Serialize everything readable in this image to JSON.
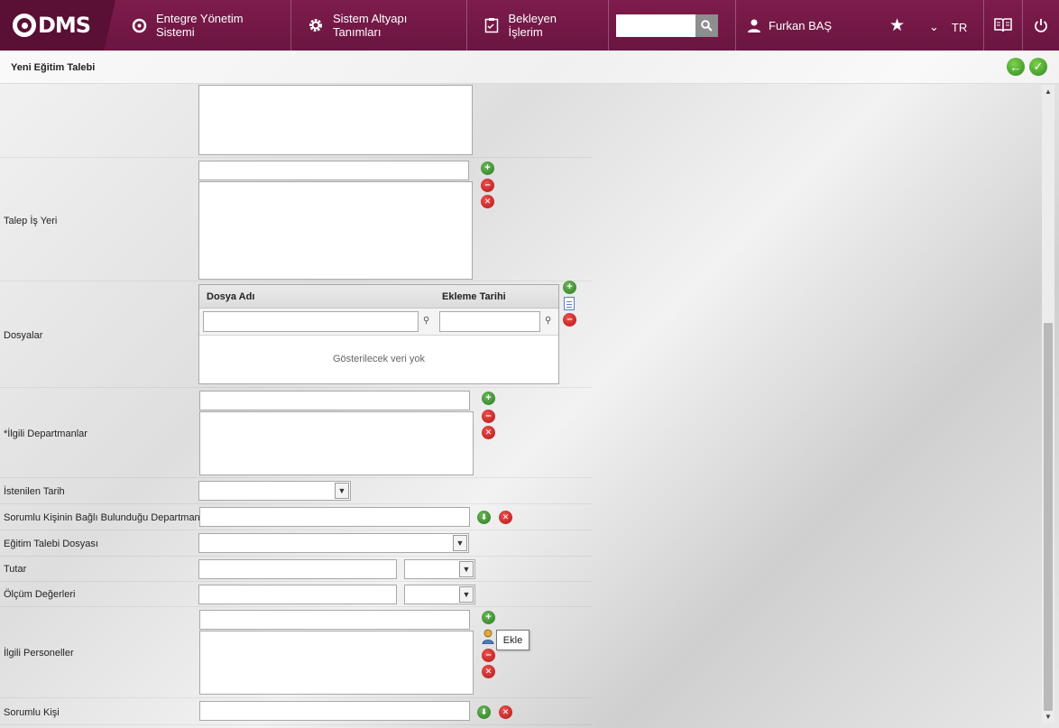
{
  "header": {
    "logo_text": "DMS",
    "nav": [
      {
        "label": "Entegre Yönetim Sistemi",
        "icon": "q-logo-icon"
      },
      {
        "label": "Sistem Altyapı Tanımları",
        "icon": "gear-icon"
      },
      {
        "label": "Bekleyen İşlerim",
        "icon": "clipboard-icon"
      }
    ],
    "search_placeholder": "",
    "user_name": "Furkan BAŞ",
    "language": "TR"
  },
  "page": {
    "title": "Yeni Eğitim Talebi"
  },
  "form": {
    "talep_is_yeri": {
      "label": "Talep İş Yeri"
    },
    "dosyalar": {
      "label": "Dosyalar",
      "columns": [
        "Dosya Adı",
        "Ekleme Tarihi"
      ],
      "empty_text": "Gösterilecek veri yok"
    },
    "ilgili_departmanlar": {
      "label": "*İlgili Departmanlar"
    },
    "istenilen_tarih": {
      "label": "İstenilen Tarih"
    },
    "sorumlu_departman": {
      "label": "Sorumlu Kişinin Bağlı Bulunduğu Departman"
    },
    "egitim_talebi_dosyasi": {
      "label": "Eğitim Talebi Dosyası"
    },
    "tutar": {
      "label": "Tutar"
    },
    "olcum_degerleri": {
      "label": "Ölçüm Değerleri"
    },
    "ilgili_personeller": {
      "label": "İlgili Personeller"
    },
    "sorumlu_kisi": {
      "label": "Sorumlu Kişi"
    }
  },
  "tooltip": {
    "text": "Ekle"
  },
  "colors": {
    "brand": "#7d1c4c",
    "add_green": "#2a7a22",
    "remove_red": "#b01515"
  }
}
